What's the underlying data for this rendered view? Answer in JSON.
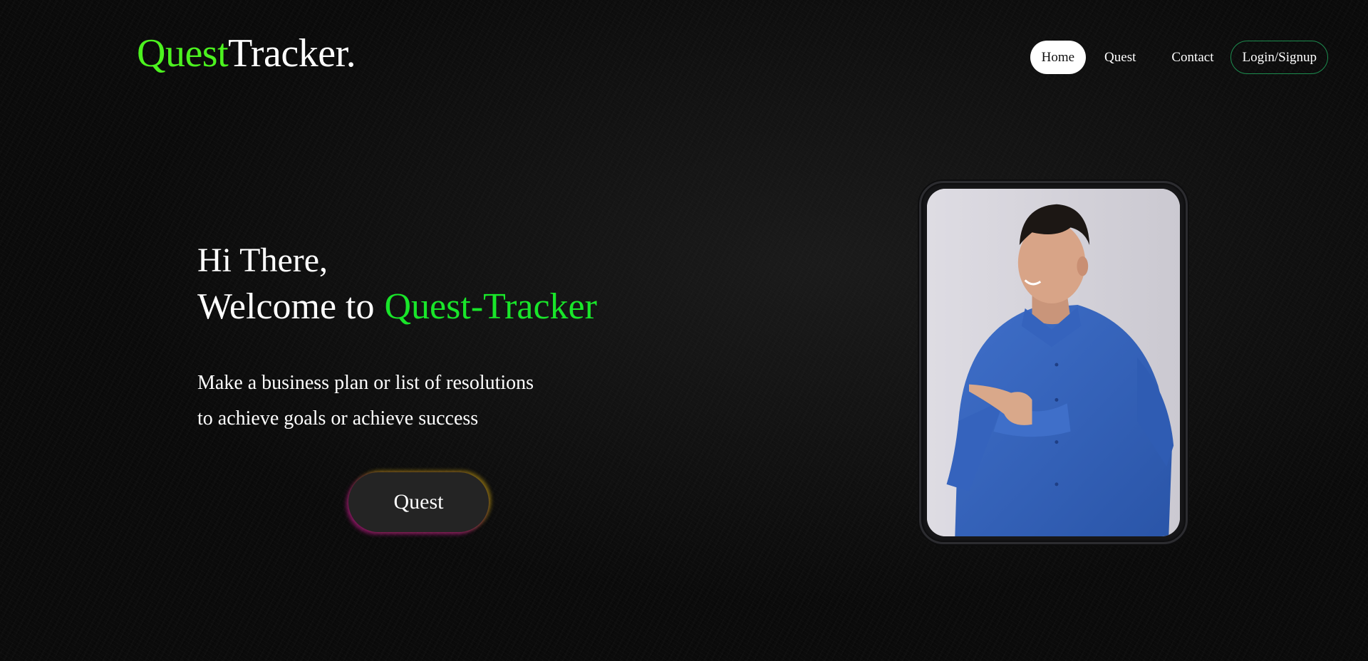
{
  "header": {
    "logo_accent": "Quest",
    "logo_rest": "Tracker."
  },
  "nav": {
    "items": [
      {
        "label": "Home",
        "active": true
      },
      {
        "label": "Quest",
        "active": false
      },
      {
        "label": "Contact",
        "active": false
      },
      {
        "label": "Login/Signup",
        "active": false
      }
    ]
  },
  "hero": {
    "greeting": "Hi There,",
    "welcome_prefix": "Welcome to",
    "brand": "Quest-Tracker",
    "tagline_line1": "Make a business plan or list of resolutions",
    "tagline_line2": "to achieve goals or achieve success",
    "cta_label": "Quest"
  },
  "colors": {
    "logo_accent": "#4cf31f",
    "brand_green": "#19e62a",
    "nav_outline": "#1d8c4f"
  },
  "image": {
    "subject": "smiling man in blue shirt pointing left"
  }
}
